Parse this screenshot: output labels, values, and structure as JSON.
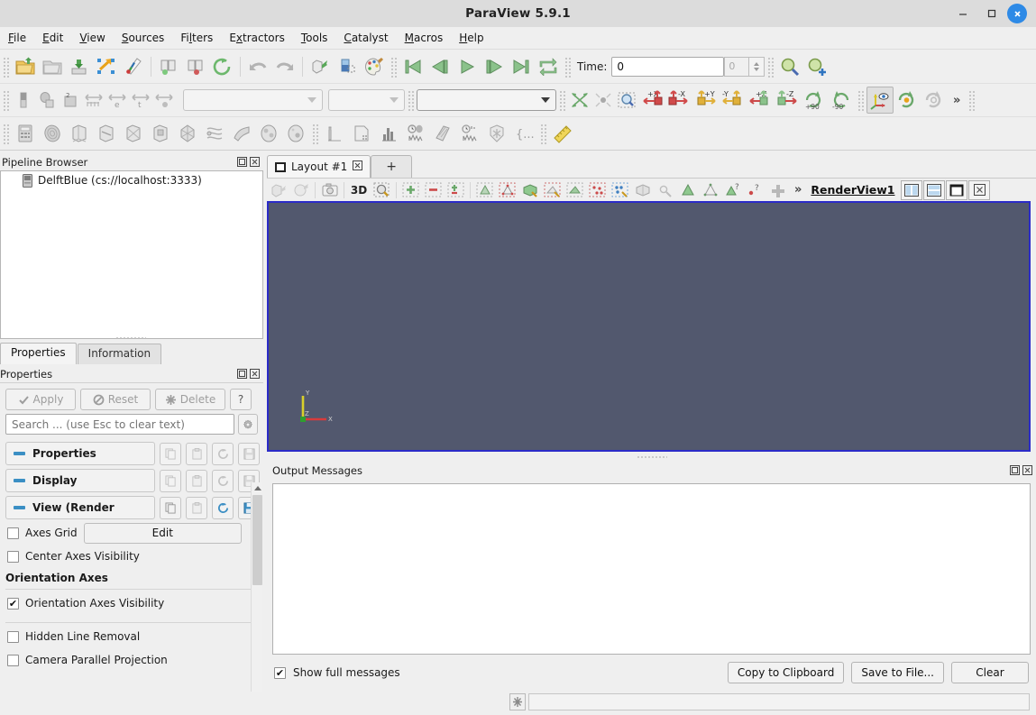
{
  "window": {
    "title": "ParaView 5.9.1",
    "controls": {
      "minimize": "—",
      "maximize": "□",
      "close": "✕"
    },
    "accent_blue": "#2e8ae6"
  },
  "menubar": {
    "items": [
      {
        "label": "File",
        "mnemonic": "F"
      },
      {
        "label": "Edit",
        "mnemonic": "E"
      },
      {
        "label": "View",
        "mnemonic": "V"
      },
      {
        "label": "Sources",
        "mnemonic": "S"
      },
      {
        "label": "Filters",
        "mnemonic": "l"
      },
      {
        "label": "Extractors",
        "mnemonic": "x"
      },
      {
        "label": "Tools",
        "mnemonic": "T"
      },
      {
        "label": "Catalyst",
        "mnemonic": "C"
      },
      {
        "label": "Macros",
        "mnemonic": "M"
      },
      {
        "label": "Help",
        "mnemonic": "H"
      }
    ]
  },
  "toolbar_main": {
    "buttons": [
      "open-file-icon",
      "recent-files-icon",
      "save-data-icon",
      "save-state-icon",
      "save-screenshot-icon",
      "connect-server-icon",
      "disconnect-server-icon",
      "reset-session-icon",
      "undo-icon",
      "redo-icon",
      "camera-undo-icon",
      "camera-redo-icon",
      "edit-color-map-icon"
    ],
    "vcr": [
      "first-frame-icon",
      "previous-frame-icon",
      "play-icon",
      "next-frame-icon",
      "last-frame-icon",
      "loop-icon"
    ],
    "time_label": "Time:",
    "time_value": "0",
    "time_index": "0",
    "magnify": [
      "zoom-to-data-icon",
      "zoom-closest-icon"
    ]
  },
  "toolbar_representation": {
    "buttons": [
      "color-legend-icon",
      "rescale-range-icon",
      "rescale-custom-icon",
      "rescale-data-range-icon",
      "rescale-visible-range-icon",
      "rescale-temporal-range-icon",
      "rescale-custom-range-icon"
    ],
    "combos": [
      "active-variable-combo",
      "component-combo",
      "representation-combo"
    ],
    "camera": [
      "reset-camera-icon",
      "zoom-to-box-icon",
      "zoom-closest-to-data-icon",
      "set-view-plus-x-icon",
      "set-view-minus-x-icon",
      "set-view-plus-y-icon",
      "set-view-minus-y-icon",
      "set-view-plus-z-icon",
      "set-view-minus-z-icon",
      "rotate-plus-90-icon",
      "rotate-minus-90-icon"
    ],
    "axis_labels": {
      "plus_x": "+X",
      "minus_x": "-X",
      "plus_y": "+Y",
      "minus_y": "-Y",
      "plus_z": "+Z",
      "minus_z": "-Z",
      "rot_plus": "+90",
      "rot_minus": "-90"
    },
    "toggles": [
      "show-center-axes-icon",
      "center-on-bounds-icon",
      "pick-center-icon"
    ],
    "overflow": "»"
  },
  "toolbar_filters": {
    "buttons": [
      "calculator-icon",
      "contour-icon",
      "clip-icon",
      "slice-icon",
      "threshold-icon",
      "extract-subset-icon",
      "glyph-icon",
      "stream-tracer-icon",
      "warp-icon",
      "group-datasets-icon",
      "extract-level-icon",
      "plot-over-line-icon",
      "plot-selection-icon",
      "histogram-icon",
      "plot-data-over-time-icon",
      "scatter-plot-icon",
      "quartile-chart-icon",
      "python-calculator-icon",
      "programmable-filter-icon",
      "measurement-ruler-icon"
    ]
  },
  "pipeline": {
    "title": "Pipeline Browser",
    "dock_buttons": [
      "undock-icon",
      "close-icon"
    ],
    "items": [
      {
        "label": "DelftBlue (cs://localhost:3333)",
        "icon": "server-icon"
      }
    ]
  },
  "properties_dock": {
    "tabs": [
      {
        "label": "Properties",
        "active": true
      },
      {
        "label": "Information",
        "active": false
      }
    ],
    "title": "Properties",
    "dock_buttons": [
      "undock-icon",
      "close-icon"
    ],
    "actions": [
      {
        "label": "Apply",
        "icon": "apply-icon",
        "enabled": false
      },
      {
        "label": "Reset",
        "icon": "reset-icon",
        "enabled": false
      },
      {
        "label": "Delete",
        "icon": "delete-icon",
        "enabled": false
      },
      {
        "label": "?",
        "icon": "help-icon",
        "enabled": true
      }
    ],
    "search_placeholder": "Search ... (use Esc to clear text)",
    "search_value": "",
    "gear": "gear-icon",
    "sections": [
      {
        "label": "Properties",
        "buttons": [
          "copy-icon",
          "paste-icon",
          "restore-defaults-icon",
          "save-defaults-icon"
        ],
        "enabled": false
      },
      {
        "label": "Display",
        "buttons": [
          "copy-icon",
          "paste-icon",
          "restore-defaults-icon",
          "save-defaults-icon"
        ],
        "enabled": false
      },
      {
        "label": "View (Render",
        "buttons": [
          "copy-icon",
          "paste-icon",
          "restore-defaults-icon",
          "save-defaults-icon"
        ],
        "enabled": true
      }
    ],
    "view_options": [
      {
        "type": "checkbox-with-button",
        "label": "Axes Grid",
        "checked": false,
        "button": "Edit"
      },
      {
        "type": "checkbox",
        "label": "Center Axes Visibility",
        "checked": false
      },
      {
        "type": "group",
        "label": "Orientation Axes"
      },
      {
        "type": "checkbox",
        "label": "Orientation Axes Visibility",
        "checked": true
      },
      {
        "type": "checkbox",
        "label": "Hidden Line Removal",
        "checked": false
      },
      {
        "type": "checkbox",
        "label": "Camera Parallel Projection",
        "checked": false
      }
    ]
  },
  "layout": {
    "tabs": [
      {
        "label": "Layout #1",
        "icon": "layout-icon",
        "closable": true,
        "close": "⊠"
      },
      {
        "label": "+",
        "icon": "add-layout-icon"
      }
    ],
    "view_toolbar": {
      "buttons": [
        "undo-camera-icon",
        "redo-camera-icon",
        "capture-screenshot-icon",
        "mode-3d-label",
        "zoom-region-icon",
        "show-all-icon",
        "hide-all-icon",
        "toggle-visibility-icon",
        "select-cells-icon",
        "select-points-icon",
        "select-surface-cells-icon",
        "select-frustum-cells-icon",
        "select-frustum-points-icon",
        "select-blocks-icon",
        "interactive-select-icon",
        "hover-cells-icon",
        "hover-points-icon",
        "select-cells-polygon-icon",
        "select-points-polygon-icon",
        "select-custom-icon",
        "add-selection-icon"
      ],
      "mode_3d_label": "3D",
      "overflow": "»",
      "view_name": "RenderView1",
      "split_buttons": [
        "split-horizontal-icon",
        "split-vertical-icon",
        "maximize-icon",
        "close-view-icon"
      ]
    },
    "render_view": {
      "background_color": "#52586e",
      "border_color": "#2b2bc8",
      "orientation_axes": {
        "x_label": "X",
        "y_label": "Y",
        "z_label": "Z",
        "x_color": "#d93b3b",
        "y_color": "#d9cf2a",
        "z_color": "#2f9e2f"
      }
    }
  },
  "output_messages": {
    "title": "Output Messages",
    "dock_buttons": [
      "undock-icon",
      "close-icon"
    ],
    "content": "",
    "show_full": {
      "label": "Show full messages",
      "checked": true
    },
    "buttons": [
      {
        "label": "Copy to Clipboard"
      },
      {
        "label": "Save to File..."
      },
      {
        "label": "Clear"
      }
    ]
  },
  "bottom_bar": {
    "button_icon": "python-shell-icon",
    "field_value": ""
  }
}
